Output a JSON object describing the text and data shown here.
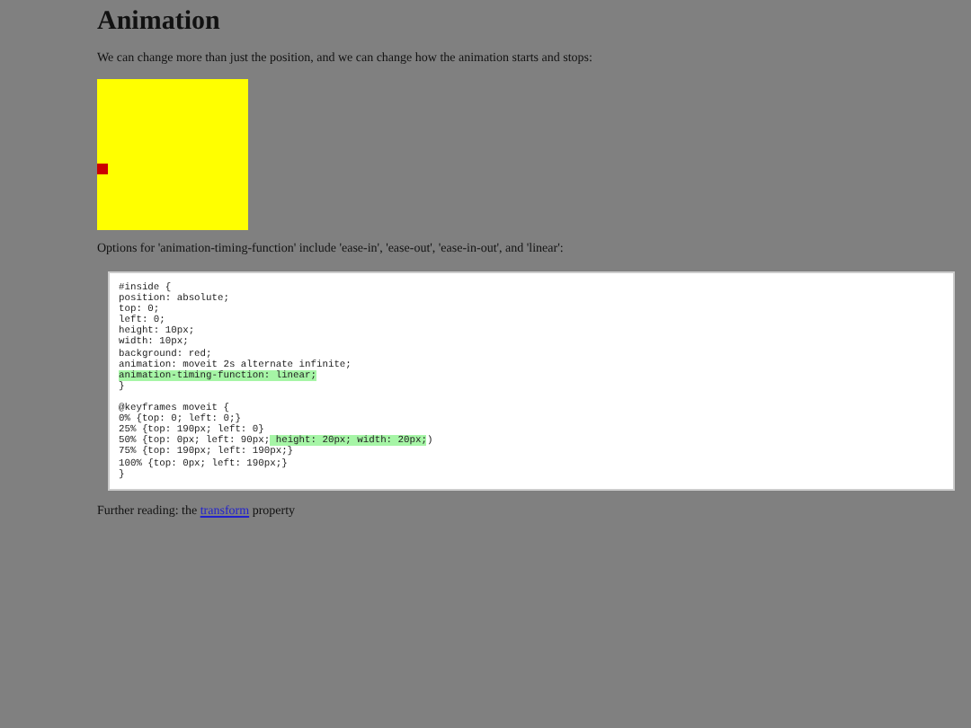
{
  "heading": "Animation",
  "intro": "We can change more than just the position, and we can change how the animation starts and stops:",
  "options_text": "Options for 'animation-timing-function' include 'ease-in', 'ease-out', 'ease-in-out', and 'linear':",
  "code_sections": [
    [
      [
        {
          "text": "#inside {",
          "highlighted": false
        }
      ],
      [
        {
          "text": "position: absolute;",
          "highlighted": false
        }
      ],
      [
        {
          "text": "top: 0;",
          "highlighted": false
        }
      ],
      [
        {
          "text": "left: 0;",
          "highlighted": false
        }
      ],
      [
        {
          "text": "height: 10px;",
          "highlighted": false
        }
      ],
      [
        {
          "text": "width: 10px;",
          "highlighted": false
        }
      ],
      [
        {
          "text": "background: red;",
          "highlighted": false
        }
      ],
      [
        {
          "text": "animation: moveit 2s alternate infinite;",
          "highlighted": false
        }
      ],
      [
        {
          "text": "animation-timing-function: linear;",
          "highlighted": true
        }
      ],
      [
        {
          "text": "}",
          "highlighted": false
        }
      ]
    ],
    [
      [
        {
          "text": "@keyframes moveit {",
          "highlighted": false
        }
      ],
      [
        {
          "text": "0% {top: 0; left: 0;}",
          "highlighted": false
        }
      ],
      [
        {
          "text": "25% {top: 190px; left: 0}",
          "highlighted": false
        }
      ],
      [
        {
          "text": "50% {top: 0px; left: 90px;",
          "highlighted": false
        },
        {
          "text": " height: 20px; width: 20px;",
          "highlighted": true
        },
        {
          "text": ")",
          "highlighted": false
        }
      ],
      [
        {
          "text": "75% {top: 190px; left: 190px;}",
          "highlighted": false
        }
      ],
      [
        {
          "text": "100% {top: 0px; left: 190px;}",
          "highlighted": false
        }
      ],
      [
        {
          "text": "}",
          "highlighted": false
        }
      ]
    ]
  ],
  "further": {
    "before": "Further reading: the",
    "link": "transform",
    "after": "property"
  }
}
